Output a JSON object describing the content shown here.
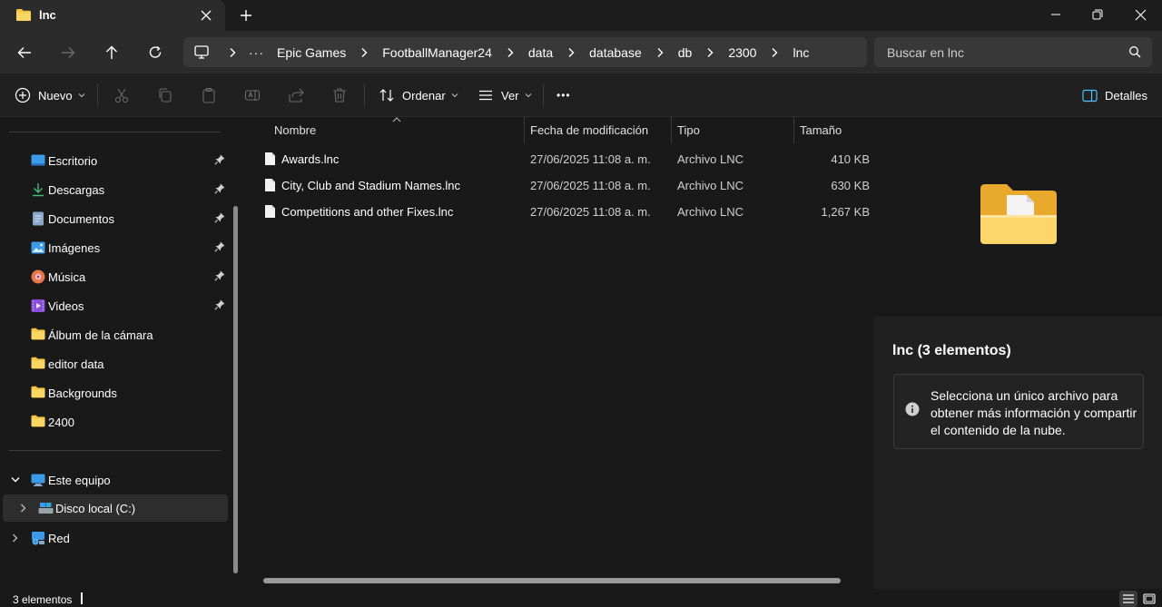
{
  "window": {
    "tab_title": "lnc",
    "icons": {
      "tab": "folder-icon",
      "close": "close-icon",
      "new_tab": "plus-icon"
    }
  },
  "address": {
    "crumbs": [
      "Epic Games",
      "FootballManager24",
      "data",
      "database",
      "db",
      "2300",
      "lnc"
    ],
    "overflow": "···",
    "search_placeholder": "Buscar en lnc"
  },
  "commands": {
    "new_label": "Nuevo",
    "sort_label": "Ordenar",
    "view_label": "Ver",
    "more": "•••",
    "details_label": "Detalles"
  },
  "sidebar": {
    "quick_access": [
      {
        "label": "Escritorio",
        "icon": "desktop-icon",
        "pinned": true
      },
      {
        "label": "Descargas",
        "icon": "download-icon",
        "pinned": true
      },
      {
        "label": "Documentos",
        "icon": "document-icon",
        "pinned": true
      },
      {
        "label": "Imágenes",
        "icon": "pictures-icon",
        "pinned": true
      },
      {
        "label": "Música",
        "icon": "music-icon",
        "pinned": true
      },
      {
        "label": "Videos",
        "icon": "video-icon",
        "pinned": true
      },
      {
        "label": "Álbum de la cámara",
        "icon": "folder-icon",
        "pinned": false
      },
      {
        "label": "editor data",
        "icon": "folder-icon",
        "pinned": false
      },
      {
        "label": "Backgrounds",
        "icon": "folder-icon",
        "pinned": false
      },
      {
        "label": "2400",
        "icon": "folder-icon",
        "pinned": false
      }
    ],
    "this_pc": "Este equipo",
    "local_disk": "Disco local (C:)",
    "network": "Red"
  },
  "file_list": {
    "columns": {
      "name": "Nombre",
      "modified": "Fecha de modificación",
      "type": "Tipo",
      "size": "Tamaño"
    },
    "rows": [
      {
        "name": "Awards.lnc",
        "modified": "27/06/2025 11:08 a. m.",
        "type": "Archivo LNC",
        "size": "410 KB"
      },
      {
        "name": "City, Club and Stadium Names.lnc",
        "modified": "27/06/2025 11:08 a. m.",
        "type": "Archivo LNC",
        "size": "630 KB"
      },
      {
        "name": "Competitions and other Fixes.lnc",
        "modified": "27/06/2025 11:08 a. m.",
        "type": "Archivo LNC",
        "size": "1,267 KB"
      }
    ]
  },
  "details": {
    "title": "lnc (3 elementos)",
    "message": "Selecciona un único archivo para obtener más información y compartir el contenido de la nube."
  },
  "status": {
    "count": "3 elementos"
  },
  "colors": {
    "folder": "#f6c445",
    "accent": "#4cc2ff"
  }
}
